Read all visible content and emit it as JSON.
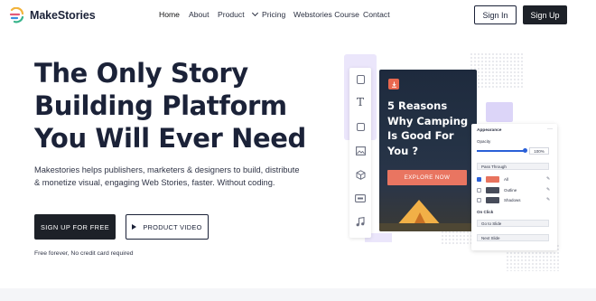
{
  "brand": {
    "name": "MakeStories",
    "accent": "#f2c84b"
  },
  "nav": {
    "items": [
      "Home",
      "About",
      "Product",
      "Pricing",
      "Webstories Course",
      "Contact"
    ],
    "sign_in": "Sign In",
    "sign_up": "Sign Up"
  },
  "hero": {
    "headline_line1_pre": "The Only ",
    "headline_highlight": "Story",
    "headline_line2": "Building Platform",
    "headline_line3": "You Will Ever Need",
    "subtitle": "Makestories helps publishers, marketers & designers to build, distribute & monetize visual, engaging Web Stories, faster. Without coding.",
    "cta_primary": "SIGN UP FOR FREE",
    "cta_secondary": "PRODUCT VIDEO",
    "note": "Free forever, No credit card required"
  },
  "editor": {
    "story_title": "5 Reasons Why Camping Is Good For You ?",
    "story_button": "EXPLORE NOW",
    "panel": {
      "heading": "Appearance",
      "opacity_label": "Opacity",
      "opacity_value": "100%",
      "blend_mode": "Pass Through",
      "layers": [
        {
          "label": "All",
          "color": "#e8735e",
          "checked": true
        },
        {
          "label": "Outline",
          "color": "#474c5a",
          "checked": false
        },
        {
          "label": "Shadows",
          "color": "#474c5a",
          "checked": false
        }
      ],
      "on_click_label": "On Click",
      "on_click_action": "Go to Slide",
      "on_click_target": "Next Slide"
    }
  }
}
